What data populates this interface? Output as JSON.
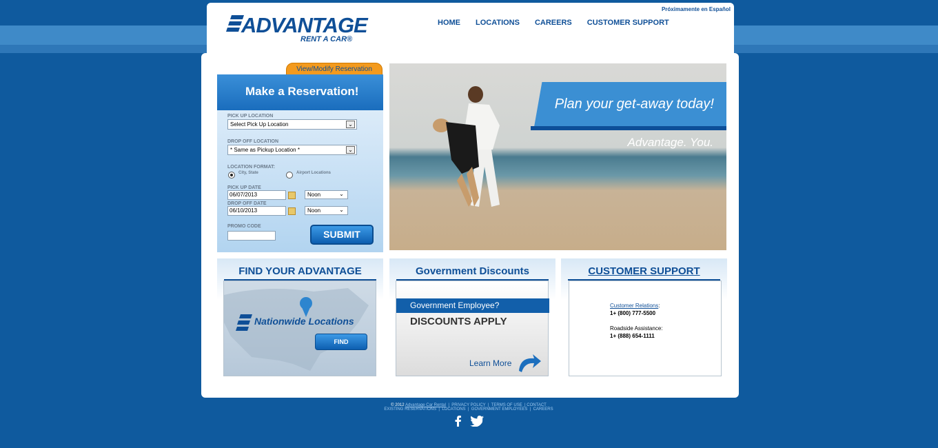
{
  "header": {
    "logo_word": "ADVANTAGE",
    "logo_sub": "RENT A CAR®",
    "espanol": "Próximamente en Español",
    "nav": [
      "HOME",
      "LOCATIONS",
      "CAREERS",
      "CUSTOMER SUPPORT"
    ]
  },
  "reservation": {
    "tab": "View/Modify Reservation",
    "title": "Make a Reservation!",
    "pickup_label": "PICK UP LOCATION",
    "pickup_value": "Select Pick Up Location",
    "dropoff_label": "DROP OFF LOCATION",
    "dropoff_value": "* Same as Pickup Location *",
    "format_label": "LOCATION FORMAT:",
    "format_city": "City, State",
    "format_airport": "Airport Locations",
    "pickup_date_label": "PICK UP DATE",
    "pickup_date": "06/07/2013",
    "pickup_time": "Noon",
    "dropoff_date_label": "DROP OFF DATE",
    "dropoff_date": "06/10/2013",
    "dropoff_time": "Noon",
    "promo_label": "PROMO CODE",
    "submit": "SUBMIT"
  },
  "hero": {
    "title": "Plan your get-away today!",
    "tagline": "Advantage. You."
  },
  "panels": {
    "find": {
      "title": "FIND YOUR ADVANTAGE",
      "sub": "Nationwide Locations",
      "button": "FIND"
    },
    "gov": {
      "title": "Government Discounts",
      "strip": "Government Employee?",
      "headline": "DISCOUNTS APPLY",
      "learn": "Learn More"
    },
    "support": {
      "title": "CUSTOMER SUPPORT",
      "relations_label": "Customer Relations",
      "relations_phone": "1+ (800) 777-5500",
      "roadside_label": "Roadside Assistance:",
      "roadside_phone": "1+ (888) 654-1111"
    }
  },
  "footer": {
    "copyright": "© 2012",
    "company_link": "Advantage Car Rental",
    "links_row1": [
      "PRIVACY POLICY",
      "TERMS OF USE",
      "CONTACT"
    ],
    "links_row2": [
      "EXISTING RESERVATIONS",
      "LOCATIONS",
      "GOVERNMENT EMPLOYEES",
      "CAREERS"
    ]
  },
  "colors": {
    "brand": "#0f4f97",
    "accent": "#f39a1e",
    "background": "#0f5a9e"
  }
}
